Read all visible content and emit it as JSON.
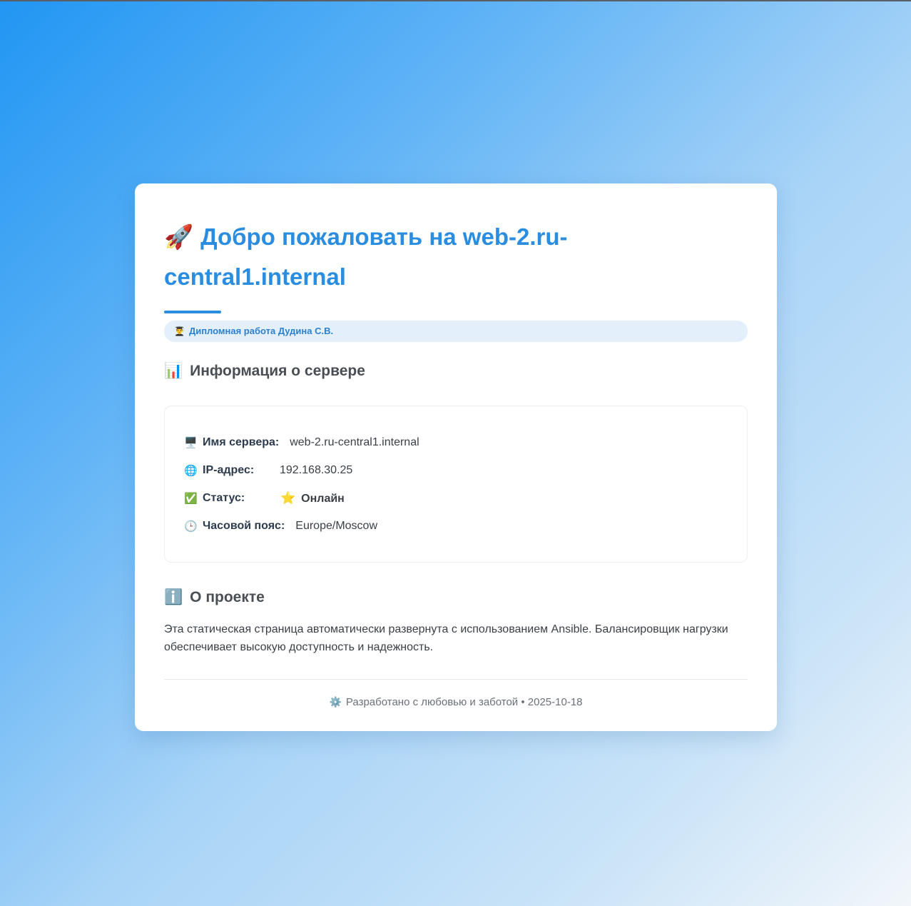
{
  "header": {
    "title_icon": "rocket-icon",
    "title_emoji": "🚀",
    "title": "Добро пожаловать на web-2.ru-central1.internal",
    "accent_color": "#2b8de0"
  },
  "badge": {
    "icon": "student-icon",
    "emoji": "👨‍🎓",
    "text": "Дипломная работа Дудина С.В."
  },
  "server_info": {
    "icon": "bar-chart-icon",
    "emoji": "📊",
    "heading": "Информация о сервере",
    "rows": [
      {
        "icon": "computer-icon",
        "emoji": "🖥️",
        "label": "Имя сервера:",
        "value": "web-2.ru-central1.internal"
      },
      {
        "icon": "globe-icon",
        "emoji": "🌐",
        "label": "IP-адрес:",
        "value": "192.168.30.25"
      },
      {
        "icon": "check-icon",
        "emoji": "✅",
        "label": "Статус:",
        "value": "Онлайн",
        "value_icon": "star-icon",
        "value_emoji": "⭐",
        "value_color": "#f5d020"
      },
      {
        "icon": "clock-icon",
        "emoji": "🕒",
        "label": "Часовой пояс:",
        "value": "Europe/Moscow"
      }
    ]
  },
  "about": {
    "icon": "info-icon",
    "emoji": "ℹ️",
    "heading": "О проекте",
    "text": "Эта статическая страница автоматически развернута с использованием Ansible. Балансировщик нагрузки обеспечивает высокую доступность и надежность."
  },
  "footer": {
    "icon": "gear-icon",
    "emoji": "⚙️",
    "text": "Разработано с любовью и заботой • 2025-10-18"
  }
}
